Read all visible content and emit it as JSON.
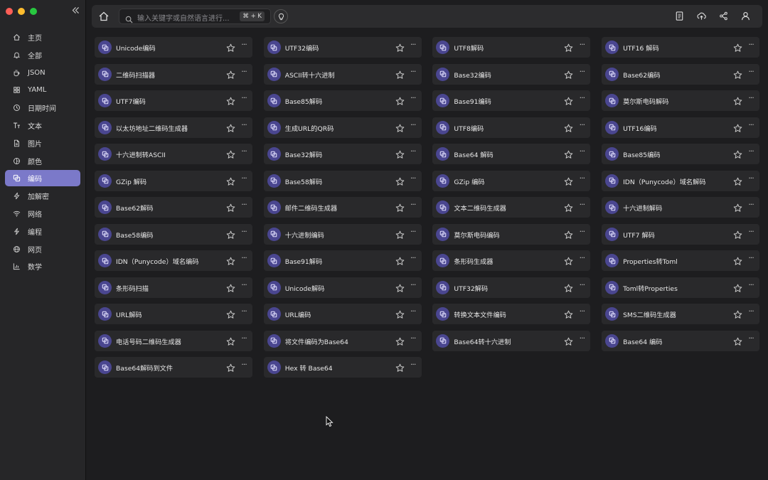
{
  "window": {
    "traffic_colors": [
      "#fe5f57",
      "#febc2e",
      "#28c840"
    ]
  },
  "sidebar": {
    "collapse_icon": "collapse-icon",
    "items": [
      {
        "label": "主页",
        "icon": "home-icon",
        "active": false
      },
      {
        "label": "全部",
        "icon": "bell-icon",
        "active": false
      },
      {
        "label": "JSON",
        "icon": "cup-icon",
        "active": false
      },
      {
        "label": "YAML",
        "icon": "grid-icon",
        "active": false
      },
      {
        "label": "日期时间",
        "icon": "clock-icon",
        "active": false
      },
      {
        "label": "文本",
        "icon": "text-icon",
        "active": false
      },
      {
        "label": "图片",
        "icon": "file-icon",
        "active": false
      },
      {
        "label": "颜色",
        "icon": "color-icon",
        "active": false
      },
      {
        "label": "编码",
        "icon": "copy-icon",
        "active": true
      },
      {
        "label": "加解密",
        "icon": "bolt-icon",
        "active": false
      },
      {
        "label": "网络",
        "icon": "wifi-icon",
        "active": false
      },
      {
        "label": "编程",
        "icon": "code-bolt-icon",
        "active": false
      },
      {
        "label": "网页",
        "icon": "globe-icon",
        "active": false
      },
      {
        "label": "数学",
        "icon": "chart-icon",
        "active": false
      }
    ]
  },
  "topbar": {
    "search_placeholder": "输入关键字或自然语言进行...",
    "shortcut": "⌘ + K",
    "right_icons": [
      "notebook-icon",
      "cloud-upload-icon",
      "share-icon",
      "user-icon"
    ]
  },
  "tools": [
    "Unicode编码",
    "UTF32编码",
    "UTF8解码",
    "UTF16 解码",
    "二维码扫描器",
    "ASCII转十六进制",
    "Base32编码",
    "Base62编码",
    "UTF7编码",
    "Base85解码",
    "Base91编码",
    "莫尔斯电码解码",
    "以太坊地址二维码生成器",
    "生成URL的QR码",
    "UTF8编码",
    "UTF16编码",
    "十六进制转ASCII",
    "Base32解码",
    "Base64 解码",
    "Base85编码",
    "GZip 解码",
    "Base58解码",
    "GZip 编码",
    "IDN（Punycode）域名解码",
    "Base62解码",
    "邮件二维码生成器",
    "文本二维码生成器",
    "十六进制解码",
    "Base58编码",
    "十六进制编码",
    "莫尔斯电码编码",
    "UTF7 解码",
    "IDN（Punycode）域名编码",
    "Base91解码",
    "条形码生成器",
    "Properties转Toml",
    "条形码扫描",
    "Unicode解码",
    "UTF32解码",
    "Toml转Properties",
    "URL解码",
    "URL编码",
    "转换文本文件编码",
    "SMS二维码生成器",
    "电话号码二维码生成器",
    "将文件编码为Base64",
    "Base64转十六进制",
    "Base64 编码",
    "Base64解码到文件",
    "Hex 转 Base64"
  ],
  "card_more_label": "···",
  "accent": "#7b79c9",
  "icon_bg": "#4a4690"
}
